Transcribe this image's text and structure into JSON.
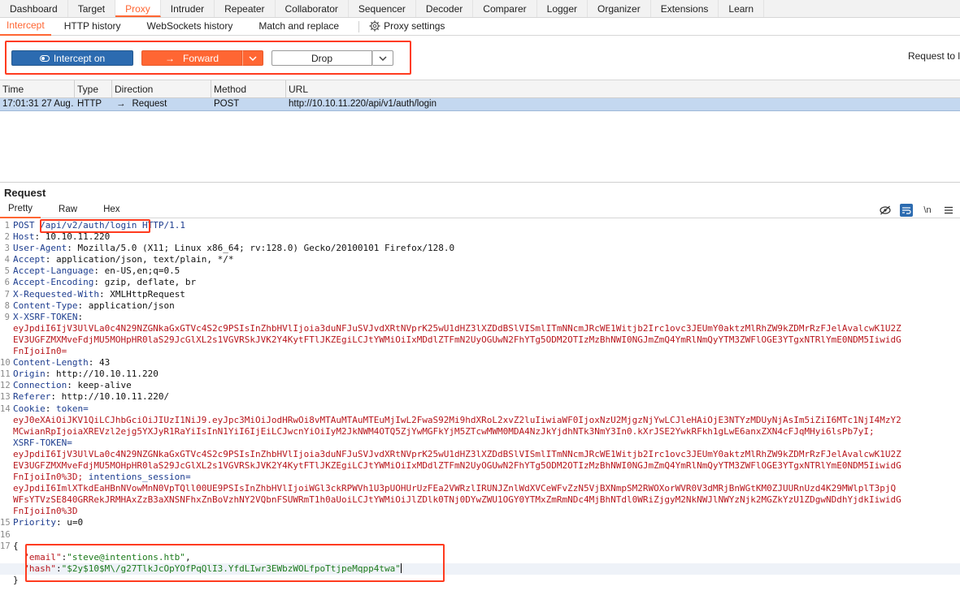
{
  "top_tabs": [
    "Dashboard",
    "Target",
    "Proxy",
    "Intruder",
    "Repeater",
    "Collaborator",
    "Sequencer",
    "Decoder",
    "Comparer",
    "Logger",
    "Organizer",
    "Extensions",
    "Learn"
  ],
  "sub_tabs": {
    "intercept": "Intercept",
    "http_history": "HTTP history",
    "websockets_history": "WebSockets history",
    "match_replace": "Match and replace",
    "proxy_settings": "Proxy settings"
  },
  "toolbar": {
    "intercept_label": "Intercept on",
    "forward_label": "Forward",
    "drop_label": "Drop",
    "request_to": "Request to l"
  },
  "table": {
    "headers": {
      "time": "Time",
      "type": "Type",
      "direction": "Direction",
      "method": "Method",
      "url": "URL"
    },
    "row": {
      "time": "17:01:31 27 Aug…",
      "type": "HTTP",
      "direction": "Request",
      "method": "POST",
      "url": "http://10.10.11.220/api/v1/auth/login"
    }
  },
  "request": {
    "title": "Request",
    "tabs": {
      "pretty": "Pretty",
      "raw": "Raw",
      "hex": "Hex"
    },
    "newline_icon": "\\n",
    "request_line": {
      "method": "POST",
      "path": "/api/v2/auth/login",
      "version": "HTTP/1.1"
    },
    "headers": [
      {
        "ln": "2",
        "name": "Host",
        "value": "10.10.11.220"
      },
      {
        "ln": "3",
        "name": "User-Agent",
        "value": "Mozilla/5.0 (X11; Linux x86_64; rv:128.0) Gecko/20100101 Firefox/128.0"
      },
      {
        "ln": "4",
        "name": "Accept",
        "value": "application/json, text/plain, */*"
      },
      {
        "ln": "5",
        "name": "Accept-Language",
        "value": "en-US,en;q=0.5"
      },
      {
        "ln": "6",
        "name": "Accept-Encoding",
        "value": "gzip, deflate, br"
      },
      {
        "ln": "7",
        "name": "X-Requested-With",
        "value": "XMLHttpRequest"
      },
      {
        "ln": "8",
        "name": "Content-Type",
        "value": "application/json"
      },
      {
        "ln": "9",
        "name": "X-XSRF-TOKEN",
        "value": ""
      }
    ],
    "xsrf_lines": [
      "eyJpdiI6IjV3UlVLa0c4N29NZGNkaGxGTVc4S2c9PSIsInZhbHVlIjoia3duNFJuSVJvdXRtNVprK25wU1dHZ3lXZDdBSlVISmlITmNNcmJRcWE1Witjb2Irc1ovc3JEUmY0aktzMlRhZW9kZDMrRzFJelAvalcwK1U2Z",
      "EV3UGFZMXMveFdjMU5MOHpHR0laS29JcGlXL2s1VGVRSkJVK2Y4KytFTlJKZEgiLCJtYWMiOiIxMDdlZTFmN2UyOGUwN2FhYTg5ODM2OTIzMzBhNWI0NGJmZmQ4YmRlNmQyYTM3ZWFlOGE3YTgxNTRlYmE0NDM5IiwidG",
      "FnIjoiIn0="
    ],
    "later_headers": [
      {
        "ln": "10",
        "name": "Content-Length",
        "value": "43"
      },
      {
        "ln": "11",
        "name": "Origin",
        "value": "http://10.10.11.220"
      },
      {
        "ln": "12",
        "name": "Connection",
        "value": "keep-alive"
      },
      {
        "ln": "13",
        "name": "Referer",
        "value": "http://10.10.11.220/"
      },
      {
        "ln": "14",
        "name": "Cookie",
        "value": "token="
      }
    ],
    "cookie_token_lines": [
      "eyJ0eXAiOiJKV1QiLCJhbGciOiJIUzI1NiJ9.eyJpc3MiOiJodHRwOi8vMTAuMTAuMTEuMjIwL2FwaS92Mi9hdXRoL2xvZ2luIiwiaWF0IjoxNzU2MjgzNjYwLCJleHAiOjE3NTYzMDUyNjAsIm5iZiI6MTc1NjI4MzY2",
      "MCwianRpIjoiaXREVzl2ejg5YXJyR1RaYiIsInN1YiI6IjEiLCJwcnYiOiIyM2JkNWM4OTQ5ZjYwMGFkYjM5ZTcwMWM0MDA4NzJkYjdhNTk3NmY3In0.kXrJSE2YwkRFkh1gLwE6anxZXN4cFJqMHyi6lsPb7yI;"
    ],
    "xsrf_cookie_name": "XSRF-TOKEN",
    "xsrf_cookie_lines": [
      "eyJpdiI6IjV3UlVLa0c4N29NZGNkaGxGTVc4S2c9PSIsInZhbHVlIjoia3duNFJuSVJvdXRtNVprK25wU1dHZ3lXZDdBSlVISmlITmNNcmJRcWE1Witjb2Irc1ovc3JEUmY0aktzMlRhZW9kZDMrRzFJelAvalcwK1U2Z",
      "EV3UGFZMXMveFdjMU5MOHpHR0laS29JcGlXL2s1VGVRSkJVK2Y4KytFTlJKZEgiLCJtYWMiOiIxMDdlZTFmN2UyOGUwN2FhYTg5ODM2OTIzMzBhNWI0NGJmZmQ4YmRlNmQyYTM3ZWFlOGE3YTgxNTRlYmE0NDM5IiwidG"
    ],
    "xsrf_cookie_tail": "FnIjoiIn0%3D; ",
    "session_cookie_name": "intentions_session",
    "session_cookie_lines": [
      "eyJpdiI6ImlXTkdEaHBnNVowMnN0VpTQll00UE9PSIsInZhbHVlIjoiWGl3ckRPWVh1U3pUOHUrUzFEa2VWRzlIRUNJZnlWdXVCeWFvZzN5VjBXNmpSM2RWOXorWVR0V3dMRjBnWGtKM0ZJUURnUzd4K29MWlplT3pjQ",
      "WFsYTVzSE840GRRekJRMHAxZzB3aXNSNFhxZnBoVzhNY2VQbnFSUWRmT1h0aUoiLCJtYWMiOiJlZDlk0TNj0DYwZWU1OGY0YTMxZmRmNDc4MjBhNTdl0WRiZjgyM2NkNWJlNWYzNjk2MGZkYzU1ZDgwNDdhYjdkIiwidG",
      "FnIjoiIn0%3D"
    ],
    "priority": {
      "ln": "15",
      "name": "Priority",
      "value": "u=0"
    },
    "body": {
      "open": "{",
      "email_key": "\"email\"",
      "email_val": "\"steve@intentions.htb\"",
      "hash_key": "\"hash\"",
      "hash_val": "\"$2y$10$M\\/g27TlkJcOpYOfPqQlI3.YfdLIwr3EWbzWOLfpoTtjpeMqpp4twa\"",
      "close": "}"
    }
  }
}
